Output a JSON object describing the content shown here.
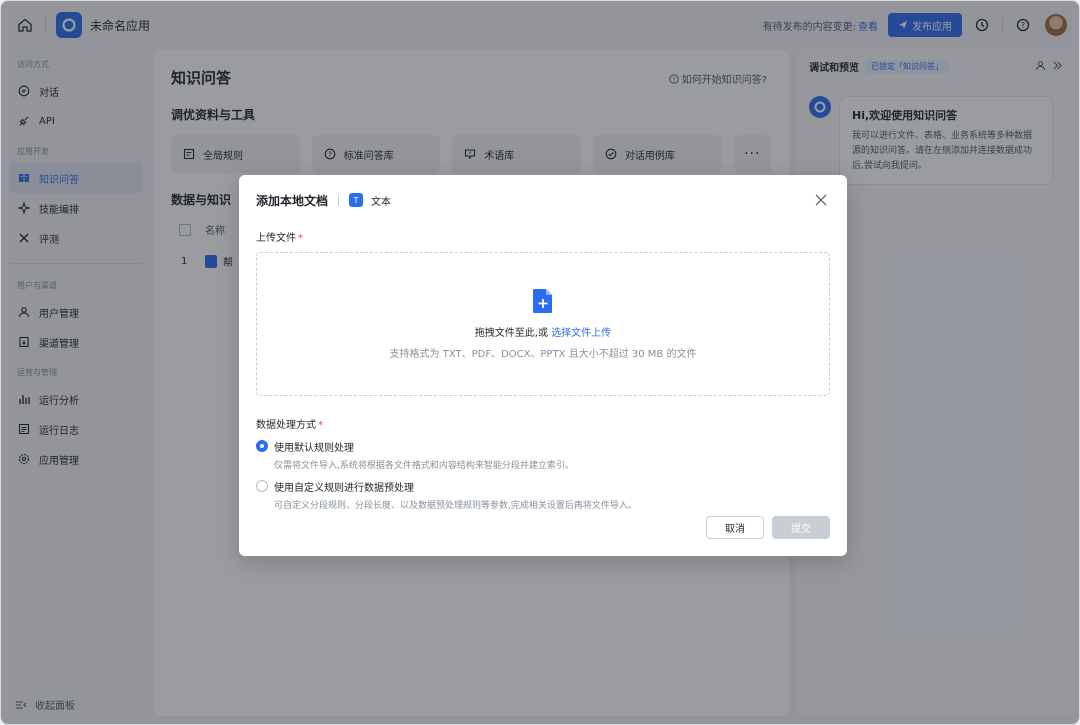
{
  "topbar": {
    "app_name": "未命名应用",
    "pending_text": "有待发布的内容变更:",
    "pending_link": "查看",
    "publish_label": "发布应用"
  },
  "sidebar": {
    "groups": [
      {
        "title": "访问方式",
        "items": [
          {
            "label": "对话",
            "icon": "chat-icon"
          },
          {
            "label": "API",
            "icon": "api-icon"
          }
        ]
      },
      {
        "title": "应用开发",
        "items": [
          {
            "label": "知识问答",
            "icon": "book-icon"
          },
          {
            "label": "技能编排",
            "icon": "sparkle-icon"
          },
          {
            "label": "评测",
            "icon": "tools-icon"
          }
        ]
      },
      {
        "title": "用户与渠道",
        "items": [
          {
            "label": "用户管理",
            "icon": "users-icon"
          },
          {
            "label": "渠道管理",
            "icon": "channel-icon"
          }
        ]
      },
      {
        "title": "运营与管理",
        "items": [
          {
            "label": "运行分析",
            "icon": "bar-chart-icon"
          },
          {
            "label": "运行日志",
            "icon": "log-icon"
          },
          {
            "label": "应用管理",
            "icon": "gear-icon"
          }
        ]
      }
    ],
    "collapse_label": "收起面板"
  },
  "main": {
    "title": "知识问答",
    "help_link": "如何开始知识问答?",
    "tools_title": "调优资料与工具",
    "tools": [
      {
        "label": "全局规则",
        "icon": "rule-icon"
      },
      {
        "label": "标准问答库",
        "icon": "question-icon"
      },
      {
        "label": "术语库",
        "icon": "glossary-icon"
      },
      {
        "label": "对话用例库",
        "icon": "check-icon"
      }
    ],
    "more_label": "···",
    "data_title": "数据与知识",
    "table_header": "名称",
    "rows": [
      {
        "index": "1",
        "name": "帮"
      }
    ]
  },
  "preview": {
    "title": "调试和预览",
    "lock_tag": "已锁定「知识问答」",
    "bubble_title": "Hi,欢迎使用知识问答",
    "bubble_text": "我可以进行文件、表格、业务系统等多种数据源的知识问答。请在左侧添加并连接数据成功后,尝试向我提问。"
  },
  "modal": {
    "title": "添加本地文档",
    "type_label": "文本",
    "type_icon_text": "T",
    "upload_label": "上传文件",
    "dropzone_text": "拖拽文件至此,或",
    "dropzone_link": "选择文件上传",
    "dropzone_hint": "支持格式为 TXT、PDF、DOCX、PPTX 且大小不超过 30 MB 的文件",
    "processing_label": "数据处理方式",
    "options": [
      {
        "title": "使用默认规则处理",
        "desc": "仅需将文件导入,系统将根据各文件格式和内容结构来智能分段并建立索引。",
        "selected": true
      },
      {
        "title": "使用自定义规则进行数据预处理",
        "desc": "可自定义分段规则、分段长度、以及数据预处理规则等参数,完成相关设置后再将文件导入。",
        "selected": false
      }
    ],
    "cancel_label": "取消",
    "submit_label": "提交"
  },
  "colors": {
    "accent": "#2b6cf0",
    "required": "#f53f3f"
  }
}
